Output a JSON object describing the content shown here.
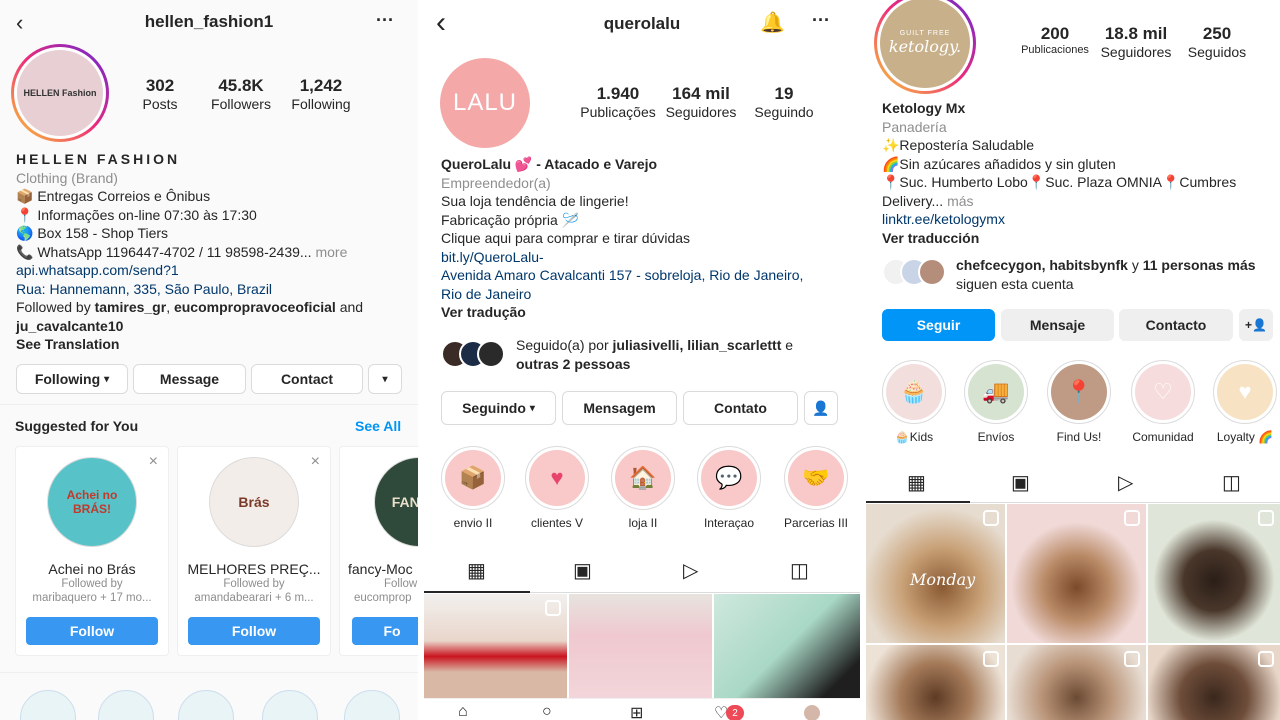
{
  "p1": {
    "username": "hellen_fashion1",
    "avatar_text": "HELLEN Fashion",
    "stats": [
      {
        "value": "302",
        "label": "Posts"
      },
      {
        "value": "45.8K",
        "label": "Followers"
      },
      {
        "value": "1,242",
        "label": "Following"
      }
    ],
    "name": "HELLEN FASHION",
    "category": "Clothing (Brand)",
    "bio": [
      "📦 Entregas Correios e Ônibus",
      "📍 Informações on-line 07:30 às 17:30",
      "🌎 Box 158 - Shop Tiers",
      "📞 WhatsApp 1196447-4702 / 11 98598-2439..."
    ],
    "more": "more",
    "link": "api.whatsapp.com/send?1",
    "address": "Rua: Hannemann, 335, São Paulo, Brazil",
    "followed_prefix": "Followed by",
    "followed_names1": "tamires_gr",
    "followed_names2": "eucompropravoceoficial",
    "followed_and": "and",
    "followed_names3": "ju_cavalcante10",
    "see_translation": "See Translation",
    "buttons": {
      "following": "Following",
      "message": "Message",
      "contact": "Contact"
    },
    "suggested_title": "Suggested for You",
    "see_all": "See All",
    "suggestions": [
      {
        "name": "Achei no Brás",
        "sub1": "Followed by",
        "sub2": "maribaquero + 17 mo...",
        "avatar": "Achei no BRÁS!",
        "follow": "Follow"
      },
      {
        "name": "MELHORES PREÇ...",
        "sub1": "Followed by",
        "sub2": "amandabearari + 6 m...",
        "avatar": "Brás",
        "follow": "Follow"
      },
      {
        "name": "fancy-Moc",
        "sub1": "Follow",
        "sub2": "eucomprop",
        "avatar": "FAN MO",
        "follow": "Fo"
      }
    ]
  },
  "p2": {
    "username": "querolalu",
    "avatar_text": "LALU",
    "stats": [
      {
        "value": "1.940",
        "label": "Publicações"
      },
      {
        "value": "164 mil",
        "label": "Seguidores"
      },
      {
        "value": "19",
        "label": "Seguindo"
      }
    ],
    "name": "QueroLalu 💕 - Atacado e Varejo",
    "category": "Empreendedor(a)",
    "bio": [
      "Sua loja tendência de lingerie!",
      "Fabricação própria 🪡",
      "Clique aqui para comprar e tirar dúvidas"
    ],
    "link": "bit.ly/QueroLalu-",
    "address1": "Avenida Amaro Cavalcanti 157 - sobreloja, Rio de Janeiro,",
    "address2": "Rio de Janeiro",
    "translate": "Ver tradução",
    "followed_prefix": "Seguido(a) por",
    "followed_names": "juliasivelli, lilian_scarlettt",
    "followed_e": "e",
    "followed_others": "outras 2 pessoas",
    "buttons": {
      "following": "Seguindo",
      "message": "Mensagem",
      "contact": "Contato"
    },
    "highlights": [
      {
        "label": "envio II",
        "icon": "📦"
      },
      {
        "label": "clientes V",
        "icon": "♥"
      },
      {
        "label": "loja II",
        "icon": "🏠"
      },
      {
        "label": "Interaçao",
        "icon": "💬"
      },
      {
        "label": "Parcerias III",
        "icon": "🤝"
      }
    ],
    "nav_badge": "2"
  },
  "p3": {
    "avatar_text": "ketology.",
    "avatar_sub": "GUILT FREE",
    "stats": [
      {
        "value": "200",
        "label": "Publicaciones"
      },
      {
        "value": "18.8 mil",
        "label": "Seguidores"
      },
      {
        "value": "250",
        "label": "Seguidos"
      }
    ],
    "name": "Ketology Mx",
    "category": "Panadería",
    "bio": [
      "✨Repostería Saludable",
      "🌈Sin azúcares añadidos y sin gluten",
      "📍Suc. Humberto Lobo📍Suc. Plaza OMNIA📍Cumbres"
    ],
    "bio_last": "Delivery...",
    "more": "más",
    "link": "linktr.ee/ketologymx",
    "translate": "Ver traducción",
    "followed_names": "chefcecygon, habitsbynfk",
    "followed_y": "y",
    "followed_others": "11 personas más",
    "followed_suffix": "siguen esta cuenta",
    "buttons": {
      "follow": "Seguir",
      "message": "Mensaje",
      "contact": "Contacto"
    },
    "highlights": [
      {
        "label": "🧁Kids",
        "icon": "🧁"
      },
      {
        "label": "Envíos",
        "icon": "🚚"
      },
      {
        "label": "Find Us!",
        "icon": "📍"
      },
      {
        "label": "Comunidad",
        "icon": "♡"
      },
      {
        "label": "Loyalty 🌈",
        "icon": "♥"
      }
    ],
    "post_caption": "Monday"
  }
}
